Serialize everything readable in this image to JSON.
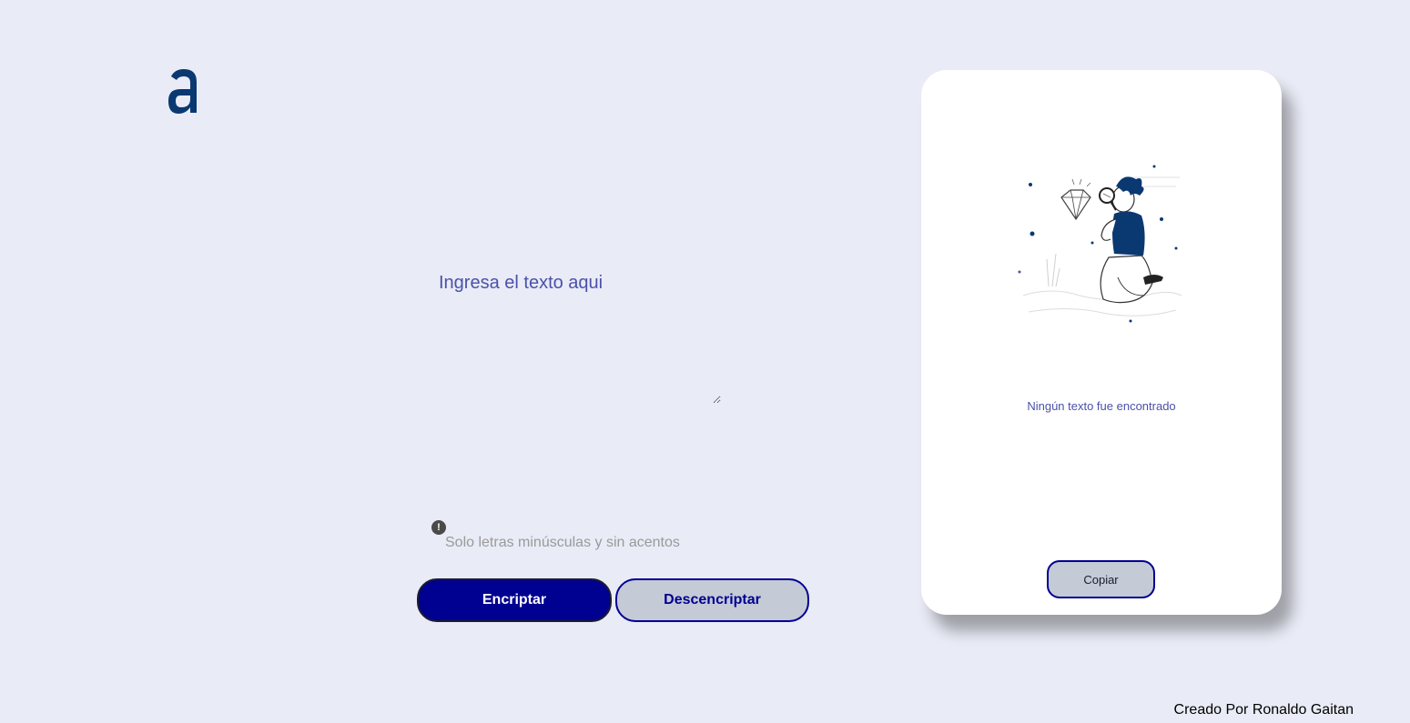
{
  "input": {
    "placeholder": "Ingresa el texto aqui",
    "hint": "Solo letras minúsculas y sin acentos",
    "hint_icon": "!"
  },
  "buttons": {
    "encrypt": "Encriptar",
    "decrypt": "Descencriptar",
    "copy": "Copiar"
  },
  "output": {
    "empty_message": "Ningún texto fue encontrado"
  },
  "footer": {
    "credit": "Creado Por Ronaldo Gaitan"
  },
  "colors": {
    "background": "#e9ebf6",
    "primary": "#000091",
    "secondary": "#c4cad6",
    "text_accent": "#4a51a8",
    "logo": "#0a3871"
  },
  "icons": {
    "logo": "alura-a-logo",
    "hint": "exclamation-circle-icon",
    "illustration": "boy-with-magnifier-illustration"
  }
}
